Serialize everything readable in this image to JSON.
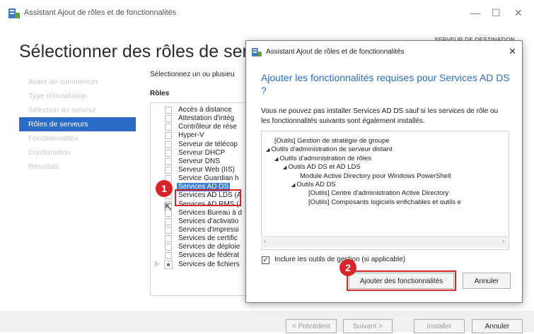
{
  "window": {
    "title": "Assistant Ajout de rôles et de fonctionnalités",
    "destination_label": "SERVEUR DE DESTINATION",
    "minimize": "—",
    "maximize": "☐",
    "close": "✕"
  },
  "page": {
    "heading": "Sélectionner des rôles de serveurs",
    "description": "Sélectionnez un ou plusieu",
    "roles_header": "Rôles"
  },
  "nav": {
    "items": [
      "Avant de commencer",
      "Type d'installation",
      "Sélection du serveur",
      "Rôles de serveurs",
      "Fonctionnalités",
      "Confirmation",
      "Résultats"
    ],
    "active_index": 3
  },
  "roles": [
    "Accès à distance",
    "Attestation d'intég",
    "Contrôleur de rése",
    "Hyper-V",
    "Serveur de télécop",
    "Serveur DHCP",
    "Serveur DNS",
    "Serveur Web (IIS)",
    "Service Guardian h",
    "Services AD DS",
    "Services AD LDS (A",
    "Services AD RMS (",
    "Services Bureau à d",
    "Services d'activatio",
    "Services d'impressi",
    "Services de certific",
    "Services de déploie",
    "Services de fédérat",
    "Services de fichiers"
  ],
  "selected_role_index": 9,
  "badges": {
    "step1": "1",
    "step2": "2"
  },
  "bottom_buttons": {
    "previous": "< Précédent",
    "next": "Suivant >",
    "install": "Installer",
    "cancel": "Annuler"
  },
  "dialog": {
    "title": "Assistant Ajout de rôles et de fonctionnalités",
    "close": "✕",
    "heading": "Ajouter les fonctionnalités requises pour Services AD DS ?",
    "description": "Vous ne pouvez pas installer Services AD DS sauf si les services de rôle ou les fonctionnalités suivants sont également installés.",
    "features": [
      {
        "text": "[Outils] Gestion de stratégie de groupe",
        "indent": 0,
        "arrow": ""
      },
      {
        "text": "Outils d'administration de serveur distant",
        "indent": 0,
        "arrow": "◢"
      },
      {
        "text": "Outils d'administration de rôles",
        "indent": 1,
        "arrow": "◢"
      },
      {
        "text": "Outils AD DS et AD LDS",
        "indent": 2,
        "arrow": "◢"
      },
      {
        "text": "Module Active Directory pour Windows PowerShell",
        "indent": 3,
        "arrow": ""
      },
      {
        "text": "Outils AD DS",
        "indent": 3,
        "arrow": "◢"
      },
      {
        "text": "[Outils] Centre d'administration Active Directory",
        "indent": 4,
        "arrow": ""
      },
      {
        "text": "[Outils] Composants logiciels enfichables et outils e",
        "indent": 4,
        "arrow": ""
      }
    ],
    "include_tools_label": "Inclure les outils de gestion (si applicable)",
    "include_tools_checked": true,
    "add_button": "Ajouter des fonctionnalités",
    "cancel_button": "Annuler"
  },
  "colors": {
    "accent": "#2b6cc7",
    "highlight_red": "#d8232a",
    "heading_blue": "#2a6cc2"
  }
}
